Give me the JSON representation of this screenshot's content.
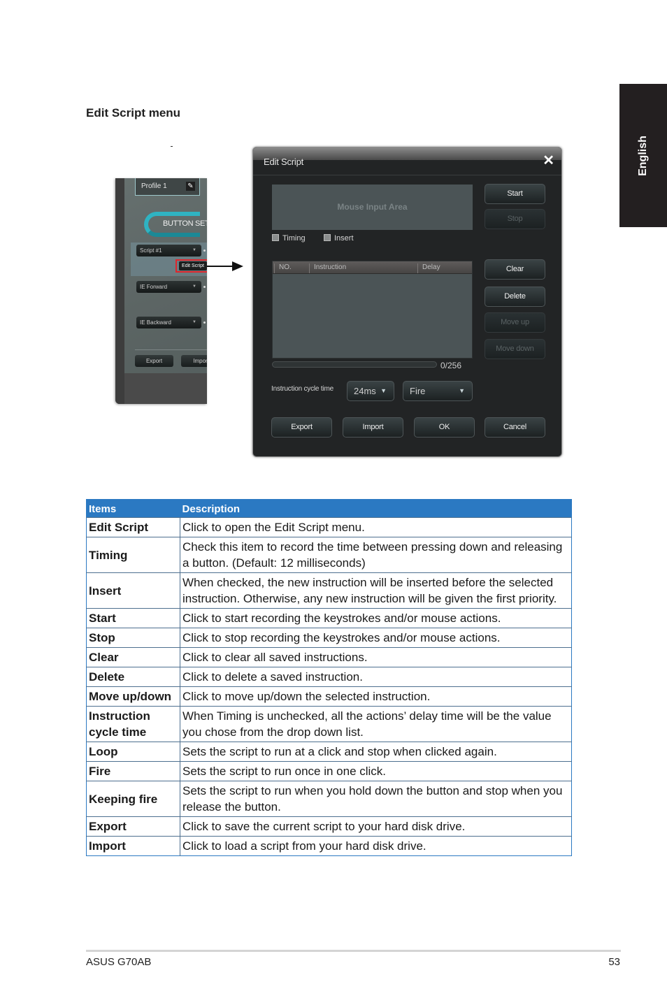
{
  "section_title": "Edit Script menu",
  "language_tab": "English",
  "app_panel": {
    "profile_label": "Profile 1",
    "button_settings_label": "BUTTON SETTIN",
    "dropdowns": [
      "Script #1",
      "IE Forward",
      "IE Backward"
    ],
    "edit_script_button": "Edit Script",
    "bottom_buttons": [
      "Export",
      "Impor"
    ],
    "accent_color": "#2fb3c2",
    "highlight_color": "#e0252b"
  },
  "dialog": {
    "title": "Edit Script",
    "mouse_input_area": "Mouse Input Area",
    "checkboxes": [
      {
        "label": "Timing",
        "checked": false
      },
      {
        "label": "Insert",
        "checked": false
      }
    ],
    "buttons": {
      "start": "Start",
      "stop": "Stop",
      "clear": "Clear",
      "delete": "Delete",
      "move_up": "Move up",
      "move_down": "Move down",
      "export": "Export",
      "import": "Import",
      "ok": "OK",
      "cancel": "Cancel"
    },
    "list_columns": [
      "NO.",
      "Instruction",
      "Delay"
    ],
    "instruction_count": "0/256",
    "progress_fraction": 0,
    "cycle_time_label": "Instruction cycle time",
    "cycle_time_value": "24ms",
    "mode_value": "Fire"
  },
  "table": {
    "headers": [
      "Items",
      "Description"
    ],
    "header_color": "#2b79c2",
    "rows": [
      {
        "item": "Edit Script",
        "desc": "Click to open the Edit Script menu."
      },
      {
        "item": "Timing",
        "desc": "Check this item to record the time between pressing down and releasing a button. (Default: 12 milliseconds)"
      },
      {
        "item": "Insert",
        "desc": "When checked, the new instruction will be inserted before the selected instruction. Otherwise, any new instruction will be given the first priority."
      },
      {
        "item": "Start",
        "desc": "Click to start recording the keystrokes and/or mouse actions."
      },
      {
        "item": "Stop",
        "desc": "Click to stop recording the keystrokes and/or mouse actions."
      },
      {
        "item": "Clear",
        "desc": "Click to clear all saved instructions."
      },
      {
        "item": "Delete",
        "desc": "Click to delete a saved instruction."
      },
      {
        "item": "Move up/down",
        "desc": "Click to move up/down the selected instruction."
      },
      {
        "item": "Instruction cycle time",
        "desc": "When Timing is unchecked, all the actions’ delay time will be the value you chose from the drop down list."
      },
      {
        "item": "Loop",
        "desc": "Sets the script to run at a click and stop when clicked again."
      },
      {
        "item": "Fire",
        "desc": "Sets the script to run once in one click."
      },
      {
        "item": "Keeping fire",
        "desc": "Sets the script to run when you hold down the button and stop when you release the button."
      },
      {
        "item": "Export",
        "desc": "Click to save the current script to your hard disk drive."
      },
      {
        "item": "Import",
        "desc": "Click to load a script from your hard disk drive."
      }
    ]
  },
  "footer": {
    "product": "ASUS G70AB",
    "page_number": "53"
  }
}
